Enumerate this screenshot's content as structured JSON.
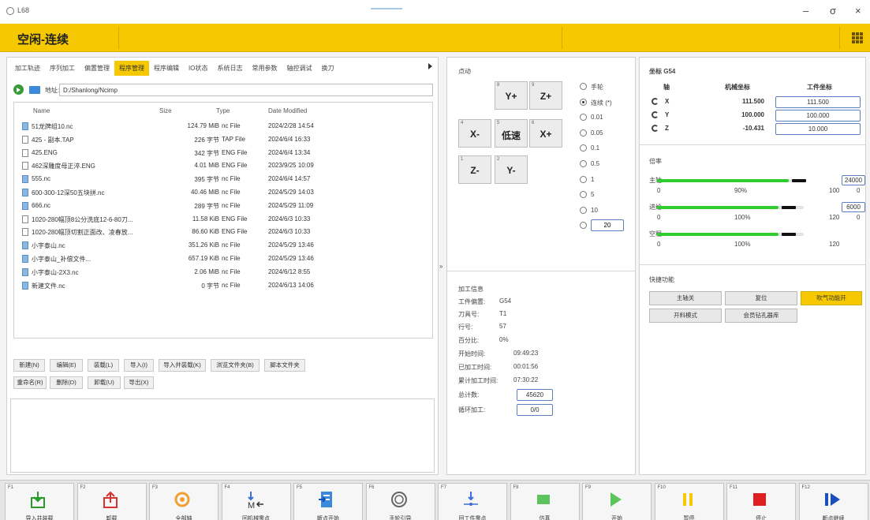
{
  "window": {
    "app_name": "L68",
    "minimize": "–",
    "maximize": "σ",
    "close": "×"
  },
  "status": {
    "title": "空闲-连续",
    "accent": "#f5c800"
  },
  "tabs": [
    "加工轨迹",
    "序列加工",
    "偏置管理",
    "程序管理",
    "程序编辑",
    "IO状态",
    "系统日志",
    "常用参数",
    "轴控调试",
    "换刀"
  ],
  "active_tab": "程序管理",
  "address": {
    "label": "地址:",
    "value": "D:/Shanlong/Ncimp"
  },
  "files": {
    "headers": {
      "name": "Name",
      "size": "Size",
      "type": "Type",
      "date": "Date Modified"
    },
    "rows": [
      {
        "name": "51龙牌组10.nc",
        "size": "124.79 MiB",
        "type": "nc File",
        "date": "2024/2/28 14:54",
        "icon": "nc"
      },
      {
        "name": "425 - 副本.TAP",
        "size": "226 字节",
        "type": "TAP File",
        "date": "2024/6/4 16:33",
        "icon": "doc"
      },
      {
        "name": "425.ENG",
        "size": "342 字节",
        "type": "ENG File",
        "date": "2024/6/4 13:34",
        "icon": "doc"
      },
      {
        "name": "462深雕度母正淬.ENG",
        "size": "4.01 MiB",
        "type": "ENG File",
        "date": "2023/9/25 10:09",
        "icon": "doc"
      },
      {
        "name": "555.nc",
        "size": "395 字节",
        "type": "nc File",
        "date": "2024/6/4 14:57",
        "icon": "nc"
      },
      {
        "name": "600-300-12深50五块拼.nc",
        "size": "40.46 MiB",
        "type": "nc File",
        "date": "2024/5/29 14:03",
        "icon": "nc"
      },
      {
        "name": "666.nc",
        "size": "289 字节",
        "type": "nc File",
        "date": "2024/5/29 11:09",
        "icon": "nc"
      },
      {
        "name": "1020-280幅顶8公分洗底12-6-80刀...",
        "size": "11.58 KiB",
        "type": "ENG File",
        "date": "2024/6/3 10:33",
        "icon": "doc"
      },
      {
        "name": "1020-280幅顶切割正面改、凌春放...",
        "size": "86.60 KiB",
        "type": "ENG File",
        "date": "2024/6/3 10:33",
        "icon": "doc"
      },
      {
        "name": "小字泰山.nc",
        "size": "351.26 KiB",
        "type": "nc File",
        "date": "2024/5/29 13:46",
        "icon": "nc"
      },
      {
        "name": "小字泰山_补偿文件...",
        "size": "657.19 KiB",
        "type": "nc File",
        "date": "2024/5/29 13:46",
        "icon": "nc"
      },
      {
        "name": "小字泰山-2X3.nc",
        "size": "2.06 MiB",
        "type": "nc File",
        "date": "2024/6/12 8:55",
        "icon": "nc"
      },
      {
        "name": "新建文件.nc",
        "size": "0 字节",
        "type": "nc File",
        "date": "2024/6/13 14:06",
        "icon": "nc"
      }
    ]
  },
  "file_buttons": {
    "row1": [
      "新建(N)",
      "编辑(E)",
      "装载(L)",
      "导入(I)",
      "导入并装载(K)",
      "浏览文件夹(B)",
      "脚本文件夹"
    ],
    "row2": [
      "重命名(R)",
      "删除(D)",
      "卸载(U)",
      "导出(X)"
    ]
  },
  "jog": {
    "title": "点动",
    "buttons": [
      {
        "num": "8",
        "label": "Y+"
      },
      {
        "num": "9",
        "label": "Z+"
      },
      {
        "num": "4",
        "label": "X-"
      },
      {
        "num": "5",
        "label": "低速"
      },
      {
        "num": "6",
        "label": "X+"
      },
      {
        "num": "1",
        "label": "Z-"
      },
      {
        "num": "2",
        "label": "Y-"
      }
    ],
    "modes": [
      "手轮",
      "连续 (*)",
      "0.01",
      "0.05",
      "0.1",
      "0.5",
      "1",
      "5",
      "10"
    ],
    "selected_mode": "连续 (*)",
    "custom_step": "20"
  },
  "machining": {
    "title": "加工信息",
    "work_offset_label": "工件偏置:",
    "work_offset": "G54",
    "tool_label": "刀具号:",
    "tool": "T1",
    "line_label": "行号:",
    "line": "57",
    "percent_label": "百分比:",
    "percent": "0%",
    "start_label": "开始时间:",
    "start": "09:49:23",
    "elapsed_label": "已加工时间:",
    "elapsed": "00:01:56",
    "est_label": "累计加工时间:",
    "est": "07:30:22",
    "total_label": "总计数:",
    "total": "45620",
    "loop_label": "循环加工:",
    "loop": "0/0"
  },
  "coords": {
    "title": "坐标 G54",
    "axis_header": "轴",
    "machine_header": "机械坐标",
    "work_header": "工件坐标",
    "axes": [
      {
        "axis": "X",
        "machine": "111.500",
        "work": "111.500"
      },
      {
        "axis": "Y",
        "machine": "100.000",
        "work": "100.000"
      },
      {
        "axis": "Z",
        "machine": "-10.431",
        "work": "10.000"
      }
    ]
  },
  "override": {
    "title": "倍率",
    "rows": [
      {
        "label": "主轴",
        "min": "0",
        "pct": "90%",
        "max": "100",
        "box": "24000",
        "after": "0",
        "fill": 0.9
      },
      {
        "label": "进给",
        "min": "0",
        "pct": "100%",
        "max": "120",
        "box": "6000",
        "after": "0",
        "fill": 0.83
      },
      {
        "label": "空程",
        "min": "0",
        "pct": "100%",
        "max": "120",
        "box": "",
        "after": "",
        "fill": 0.83
      }
    ]
  },
  "quick": {
    "title": "快捷功能",
    "buttons": [
      {
        "label": "主轴关",
        "on": false
      },
      {
        "label": "复位",
        "on": false
      },
      {
        "label": "吹气功能开",
        "on": true
      },
      {
        "label": "开料模式",
        "on": false
      },
      {
        "label": "会员钻孔器库",
        "on": false
      }
    ]
  },
  "fkeys": [
    {
      "key": "F1",
      "label": "导入并装载",
      "icon": "import-load-icon",
      "color": "#2a9a2a"
    },
    {
      "key": "F2",
      "label": "卸载",
      "icon": "unload-icon",
      "color": "#d93030"
    },
    {
      "key": "F3",
      "label": "全部轴",
      "icon": "all-axes-icon",
      "color": "#f0a030"
    },
    {
      "key": "F4",
      "label": "回机械零点",
      "icon": "machine-home-icon",
      "color": "#333333"
    },
    {
      "key": "F5",
      "label": "断点开始",
      "icon": "breakpoint-start-icon",
      "color": "#3b8ad9"
    },
    {
      "key": "F6",
      "label": "手轮引导",
      "icon": "handwheel-guide-icon",
      "color": "#666666"
    },
    {
      "key": "F7",
      "label": "回工件零点",
      "icon": "work-home-icon",
      "color": "#3b6fd9"
    },
    {
      "key": "F8",
      "label": "仿真",
      "icon": "simulate-icon",
      "color": "#5cc45c"
    },
    {
      "key": "F9",
      "label": "开始",
      "icon": "start-icon",
      "color": "#5cc45c"
    },
    {
      "key": "F10",
      "label": "暂停",
      "icon": "pause-icon",
      "color": "#f5c800"
    },
    {
      "key": "F11",
      "label": "停止",
      "icon": "stop-icon",
      "color": "#e02020"
    },
    {
      "key": "F12",
      "label": "断点继续",
      "icon": "resume-icon",
      "color": "#1a4fbf"
    }
  ]
}
